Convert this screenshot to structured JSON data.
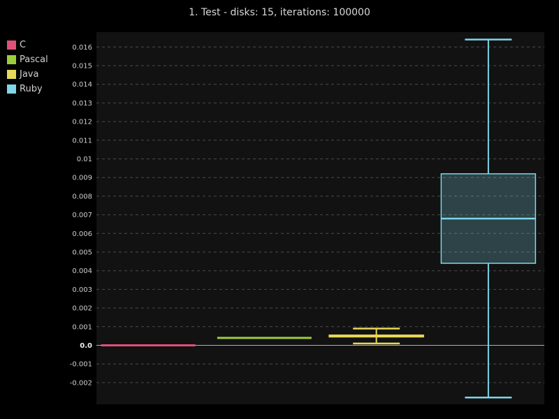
{
  "chart_data": {
    "type": "boxplot",
    "title": "1. Test - disks: 15, iterations: 100000",
    "xlabel": "",
    "ylabel": "",
    "ylim": [
      -0.003,
      0.0169
    ],
    "yticks": [
      {
        "value": 0.016,
        "label": "0.016"
      },
      {
        "value": 0.015,
        "label": "0.015"
      },
      {
        "value": 0.014,
        "label": "0.014"
      },
      {
        "value": 0.013,
        "label": "0.013"
      },
      {
        "value": 0.012,
        "label": "0.012"
      },
      {
        "value": 0.011,
        "label": "0.011"
      },
      {
        "value": 0.01,
        "label": "0.01"
      },
      {
        "value": 0.009,
        "label": "0.009"
      },
      {
        "value": 0.008,
        "label": "0.008"
      },
      {
        "value": 0.007,
        "label": "0.007"
      },
      {
        "value": 0.006,
        "label": "0.006"
      },
      {
        "value": 0.005,
        "label": "0.005"
      },
      {
        "value": 0.004,
        "label": "0.004"
      },
      {
        "value": 0.003,
        "label": "0.003"
      },
      {
        "value": 0.002,
        "label": "0.002"
      },
      {
        "value": 0.001,
        "label": "0.001"
      },
      {
        "value": 0.0,
        "label": "0.0"
      },
      {
        "value": -0.001,
        "label": "-0.001"
      },
      {
        "value": -0.002,
        "label": "-0.002"
      }
    ],
    "grid": true,
    "legend_position": "left",
    "series": [
      {
        "name": "C",
        "color": "#e0507a",
        "min": 0.0,
        "q1": 0.0,
        "median": 0.0,
        "q3": 0.0,
        "max": 0.0
      },
      {
        "name": "Pascal",
        "color": "#9ccc3c",
        "min": 0.0004,
        "q1": 0.0004,
        "median": 0.0004,
        "q3": 0.0004,
        "max": 0.0004
      },
      {
        "name": "Java",
        "color": "#e8d858",
        "min": 0.0001,
        "q1": 0.00045,
        "median": 0.0005,
        "q3": 0.00055,
        "max": 0.0009
      },
      {
        "name": "Ruby",
        "color": "#7ed6e8",
        "min": -0.0028,
        "q1": 0.0044,
        "median": 0.0068,
        "q3": 0.0092,
        "max": 0.0164
      }
    ]
  }
}
